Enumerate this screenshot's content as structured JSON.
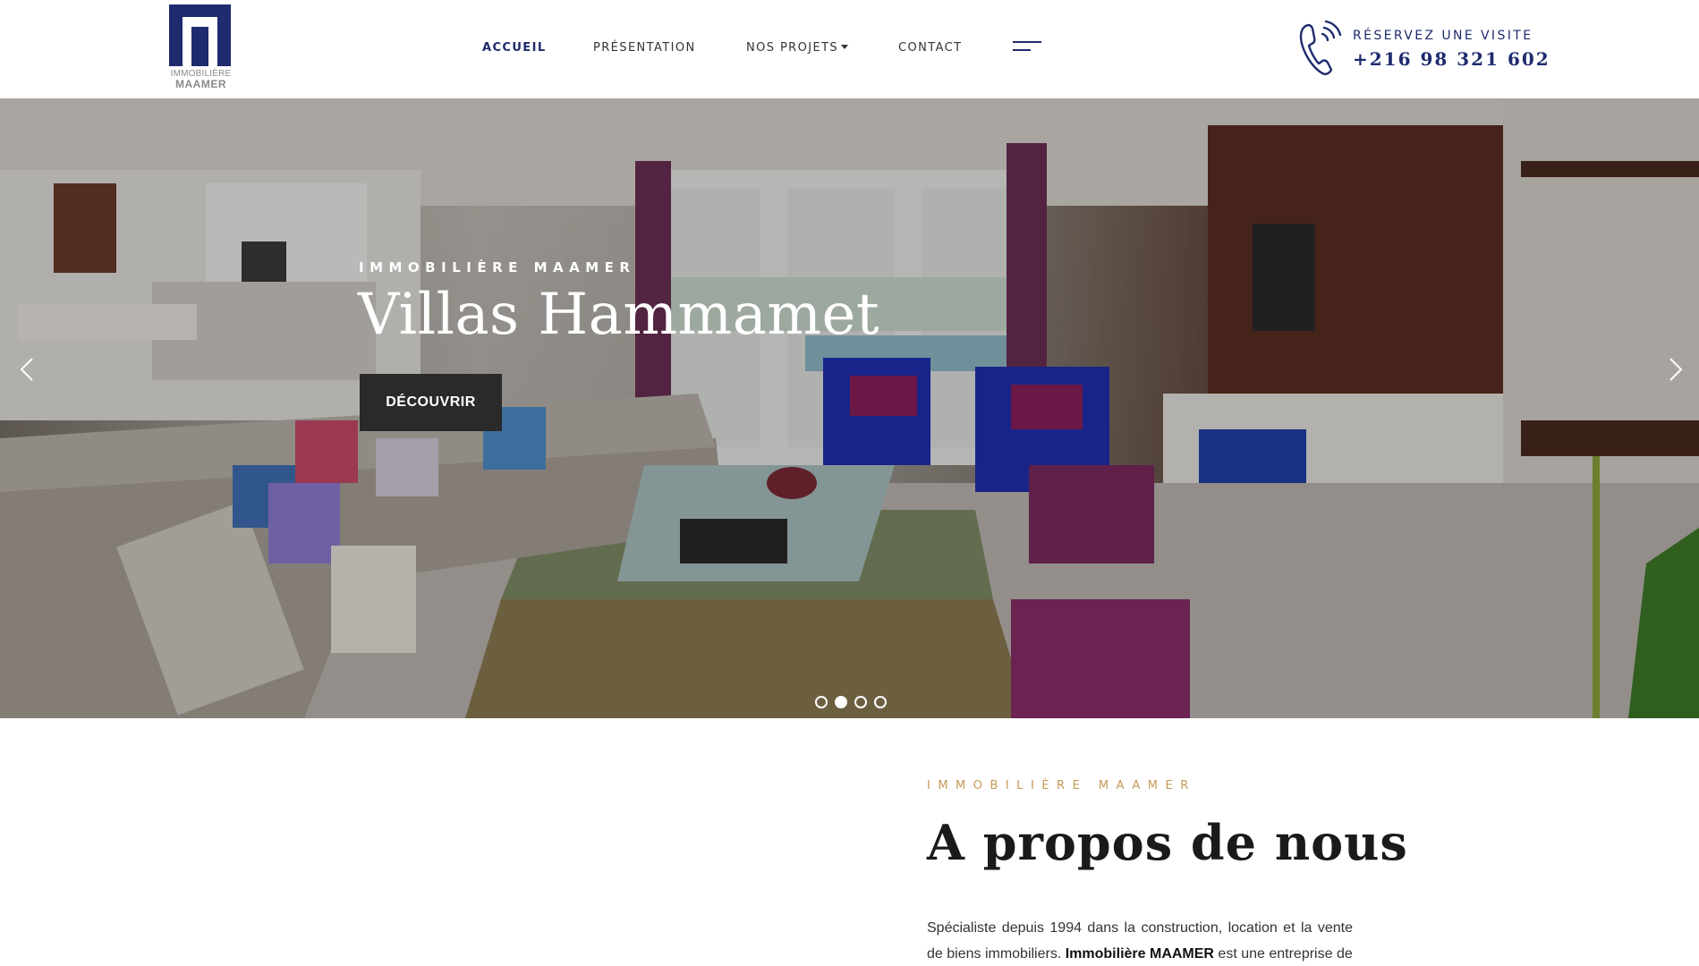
{
  "brand": {
    "logo_line1": "IMMOBILIÈRE",
    "logo_line2": "MAAMER",
    "primary_color": "#1e2b6e",
    "accent_color": "#c49a56"
  },
  "nav": {
    "items": [
      {
        "label": "ACCUEIL",
        "active": true
      },
      {
        "label": "PRÉSENTATION",
        "active": false
      },
      {
        "label": "NOS PROJETS",
        "active": false,
        "has_dropdown": true
      },
      {
        "label": "CONTACT",
        "active": false
      }
    ],
    "menu_icon": "hamburger-icon"
  },
  "cta": {
    "icon": "phone-icon",
    "label": "RÉSERVEZ UNE VISITE",
    "phone": "+216 98 321 602"
  },
  "hero": {
    "subtitle": "IMMOBILIÈRE MAAMER",
    "title": "Villas Hammamet",
    "button_label": "DÉCOUVRIR",
    "prev_icon": "chevron-left-icon",
    "next_icon": "chevron-right-icon",
    "slides_count": 4,
    "active_slide": 2
  },
  "about": {
    "eyebrow": "IMMOBILIÈRE MAAMER",
    "title": "A propos de nous",
    "text_part1": "Spécialiste depuis 1994 dans la construction, location et la vente de biens immobiliers. ",
    "text_bold": "Immobilière MAAMER",
    "text_part2": " est une entreprise de"
  }
}
